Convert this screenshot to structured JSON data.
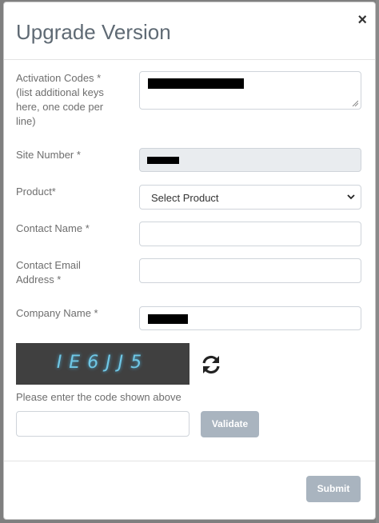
{
  "dialog": {
    "title": "Upgrade Version",
    "close_glyph": "×"
  },
  "form": {
    "activation_codes_label": "Activation Codes * (list additional keys here, one code per line)",
    "site_number_label": "Site Number *",
    "product_label": "Product*",
    "product_selected": "Select Product",
    "contact_name_label": "Contact Name *",
    "contact_email_label": "Contact Email Address *",
    "company_name_label": "Company Name *"
  },
  "captcha": {
    "code_text": "IE6JJ5",
    "hint": "Please enter the code shown above",
    "validate_label": "Validate"
  },
  "footer": {
    "submit_label": "Submit"
  },
  "icons": {
    "close": "close-icon",
    "refresh": "refresh-icon",
    "select_arrow": "chevron-down-icon"
  },
  "colors": {
    "disabled_button": "#a9b4bf",
    "title": "#5f6a74",
    "captcha_bg": "#404040",
    "captcha_text": "#70c8e6"
  }
}
